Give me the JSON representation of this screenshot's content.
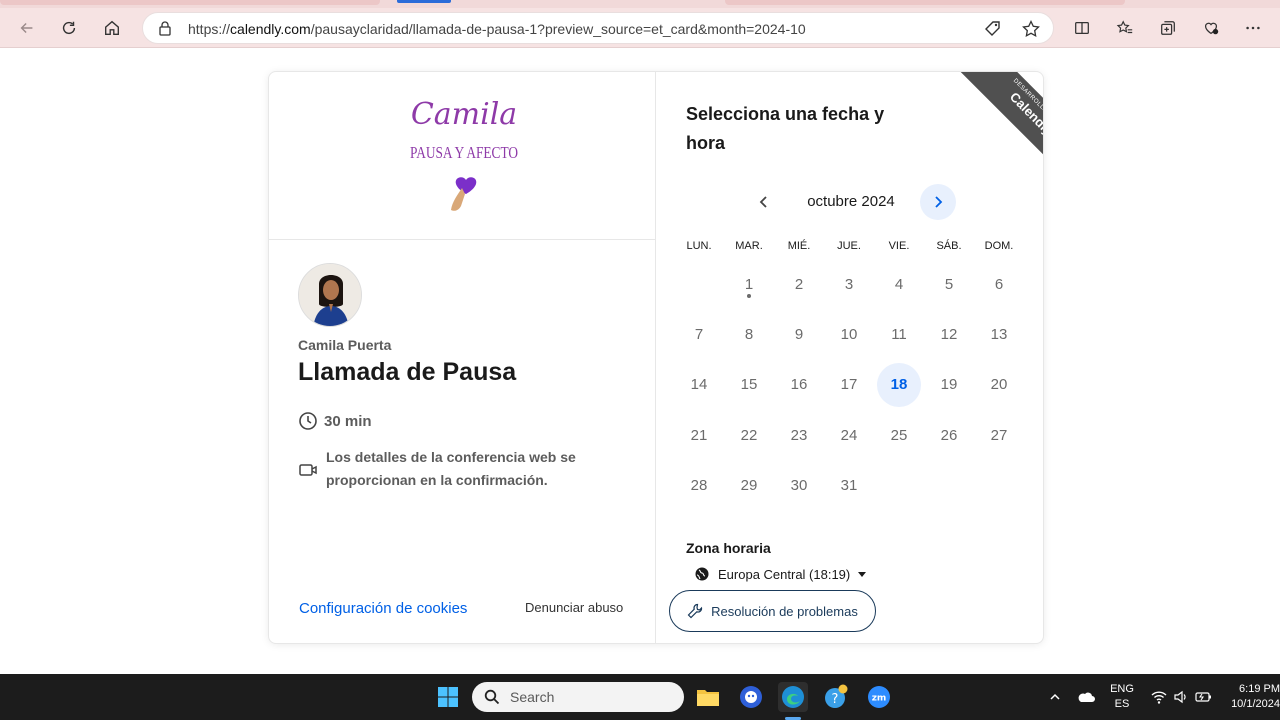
{
  "browser": {
    "url_prefix": "https://",
    "url_domain": "calendly.com",
    "url_path": "/pausayclaridad/llamada-de-pausa-1?preview_source=et_card&month=2024-10"
  },
  "logo": {
    "script_text": "Camila",
    "subtitle_text": "PAUSA Y AFECTO"
  },
  "event": {
    "host_name": "Camila Puerta",
    "title": "Llamada de Pausa",
    "duration": "30 min",
    "conference_note": "Los detalles de la conferencia web se proporcionan en la confirmación."
  },
  "footer_links": {
    "cookies": "Configuración de cookies",
    "abuse": "Denunciar abuso"
  },
  "ribbon": {
    "small": "DESARROLLADO POR",
    "big": "Calendly"
  },
  "calendar": {
    "heading": "Selecciona una fecha y hora",
    "month_label": "octubre 2024",
    "weekdays": [
      "LUN.",
      "MAR.",
      "MIÉ.",
      "JUE.",
      "VIE.",
      "SÁB.",
      "DOM."
    ],
    "first_weekday_index": 1,
    "days_in_month": 31,
    "today": 18,
    "dot_day": 1
  },
  "timezone": {
    "title": "Zona horaria",
    "value": "Europa Central (18:19)"
  },
  "troubleshoot_label": "Resolución de problemas",
  "taskbar": {
    "search_placeholder": "Search",
    "lang_top": "ENG",
    "lang_bottom": "ES",
    "time": "6:19 PM",
    "date": "10/1/2024"
  },
  "colors": {
    "accent": "#0060e6",
    "today_bg": "#e8f0fd",
    "ribbon": "#505050",
    "logo_purple": "#8e3aa8"
  }
}
